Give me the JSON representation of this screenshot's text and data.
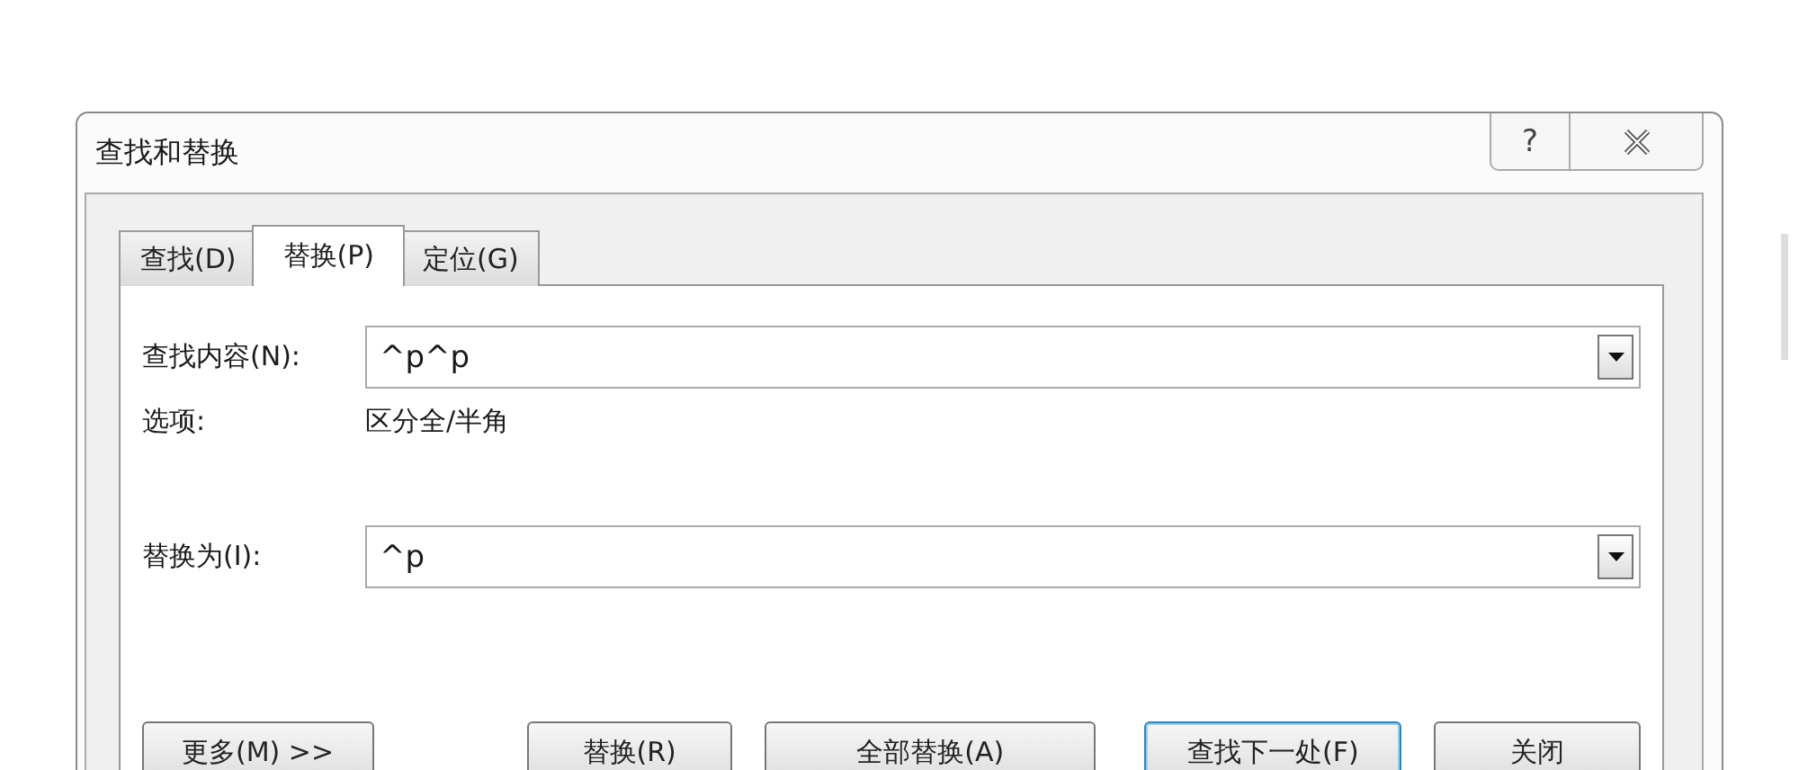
{
  "window": {
    "title": "查找和替换",
    "help": "?"
  },
  "tabs": [
    {
      "label": "查找(D)",
      "selected": false
    },
    {
      "label": "替换(P)",
      "selected": true
    },
    {
      "label": "定位(G)",
      "selected": false
    }
  ],
  "find": {
    "label": "查找内容(N):",
    "value": "^p^p"
  },
  "options": {
    "label": "选项:",
    "value": "区分全/半角"
  },
  "replace": {
    "label": "替换为(I):",
    "value": "^p"
  },
  "buttons": [
    {
      "label": "更多(M) >>",
      "default": false
    },
    {
      "label": "替换(R)",
      "default": false
    },
    {
      "label": "全部替换(A)",
      "default": false
    },
    {
      "label": "查找下一处(F)",
      "default": true
    },
    {
      "label": "关闭",
      "default": false
    }
  ]
}
